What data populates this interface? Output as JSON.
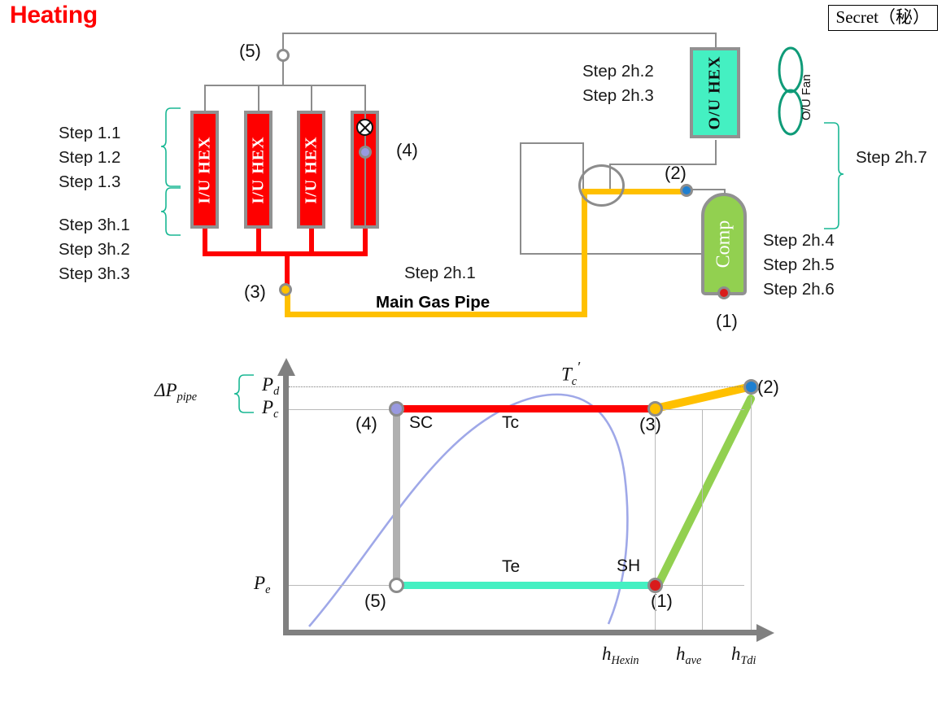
{
  "header": {
    "title": "Heating",
    "title_color": "#ff0000",
    "secret_badge": "Secret（秘）"
  },
  "schematic": {
    "indoor_steps_group1": [
      "Step 1.1",
      "Step 1.2",
      "Step 1.3"
    ],
    "indoor_steps_group2": [
      "Step 3h.1",
      "Step 3h.2",
      "Step 3h.3"
    ],
    "outdoor_hex_steps": [
      "Step 2h.2",
      "Step 2h.3"
    ],
    "comp_steps": [
      "Step 2h.4",
      "Step 2h.5",
      "Step 2h.6"
    ],
    "fan_group_step": "Step 2h.7",
    "main_pipe_step": "Step 2h.1",
    "main_pipe_label": "Main Gas Pipe",
    "indoor_units": [
      {
        "label": "I/U  HEX"
      },
      {
        "label": "I/U  HEX"
      },
      {
        "label": "I/U  HEX"
      },
      {
        "label": ""
      }
    ],
    "outdoor_hex_label": "O/U  HEX",
    "compressor_label": "Comp",
    "fan_label": "O/U Fan",
    "nodes": {
      "n1": "(1)",
      "n2": "(2)",
      "n3": "(3)",
      "n4": "(4)",
      "n5": "(5)"
    },
    "colors": {
      "indoor_hex": "#fe0000",
      "outdoor_hex": "#44f0c2",
      "compressor": "#92d050",
      "gas_pipe": "#ffc000",
      "liquid_pipe": "#fe0000",
      "plain_pipe": "#8c8c8c",
      "brace": "#18b793"
    }
  },
  "chart_data": {
    "type": "line",
    "title": "",
    "xlabel": "",
    "ylabel": "",
    "grid": true,
    "legend_position": "none",
    "y_ticks": [
      {
        "label": "P",
        "sub": "d",
        "value": 0.93,
        "style": "dotted"
      },
      {
        "label": "P",
        "sub": "c",
        "value": 0.86,
        "style": "solid"
      },
      {
        "label": "P",
        "sub": "e",
        "value": 0.165,
        "style": "solid"
      }
    ],
    "x_ticks": [
      {
        "label": "h",
        "sub": "Hexin",
        "value": 0.63
      },
      {
        "label": "h",
        "sub": "ave",
        "value": 0.745
      },
      {
        "label": "h",
        "sub": "Tdi",
        "value": 0.855
      }
    ],
    "annotations": [
      {
        "text": "T",
        "sub": "c",
        "prime": true,
        "name": "critical-temp-label"
      },
      {
        "text": "SC",
        "name": "subcool-label"
      },
      {
        "text": "Tc",
        "name": "condensing-temp-label"
      },
      {
        "text": "Te",
        "name": "evaporating-temp-label"
      },
      {
        "text": "SH",
        "name": "superheat-label"
      },
      {
        "text": "ΔP",
        "sub": "pipe",
        "name": "pipe-pressure-drop-label"
      }
    ],
    "points": [
      {
        "id": "(1)",
        "x": 0.63,
        "y": 0.165,
        "color": "#d91b1b",
        "label_pos": "below-right"
      },
      {
        "id": "(2)",
        "x": 0.855,
        "y": 0.93,
        "color": "#1f7fd0",
        "label_pos": "right"
      },
      {
        "id": "(3)",
        "x": 0.63,
        "y": 0.86,
        "color": "#ffc000",
        "label_pos": "below-right"
      },
      {
        "id": "(4)",
        "x": 0.125,
        "y": 0.86,
        "color": "#9999e0",
        "label_pos": "below-left"
      },
      {
        "id": "(5)",
        "x": 0.125,
        "y": 0.165,
        "color": "#ffffff",
        "label_pos": "below-left"
      }
    ],
    "series": [
      {
        "name": "compression (1)-(2)",
        "color": "#92d050",
        "from": "(1)",
        "to": "(2)"
      },
      {
        "name": "discharge pipe (2)-(3)",
        "color": "#ffc000",
        "from": "(2)",
        "to": "(3)"
      },
      {
        "name": "condensation (3)-(4)",
        "color": "#fe0000",
        "from": "(3)",
        "to": "(4)"
      },
      {
        "name": "expansion (4)-(5)",
        "color": "#b0b0b0",
        "from": "(4)",
        "to": "(5)"
      },
      {
        "name": "evaporation (5)-(1)",
        "color": "#44f0c2",
        "from": "(5)",
        "to": "(1)"
      },
      {
        "name": "saturation dome",
        "color": "#9fa8e8",
        "from": "",
        "to": ""
      }
    ]
  }
}
